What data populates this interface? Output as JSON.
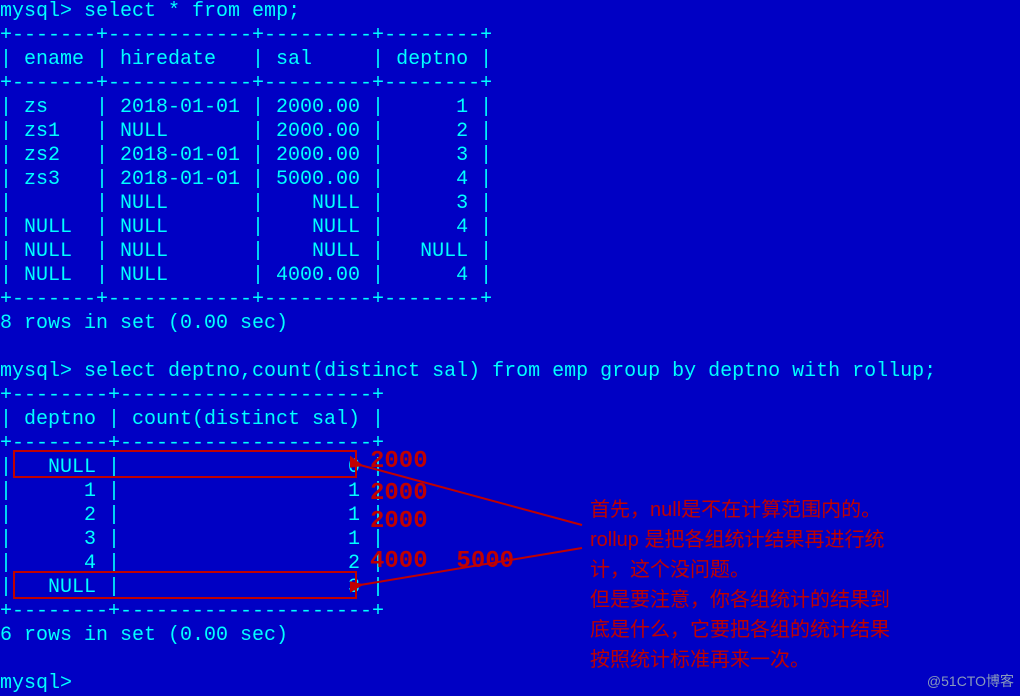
{
  "prompt": "mysql>",
  "query1": "select * from emp;",
  "border1_top": "+-------+------------+---------+--------+",
  "header1": "| ename | hiredate   | sal     | deptno |",
  "rows1": [
    "| zs    | 2018-01-01 | 2000.00 |      1 |",
    "| zs1   | NULL       | 2000.00 |      2 |",
    "| zs2   | 2018-01-01 | 2000.00 |      3 |",
    "| zs3   | 2018-01-01 | 5000.00 |      4 |",
    "|       | NULL       |    NULL |      3 |",
    "| NULL  | NULL       |    NULL |      4 |",
    "| NULL  | NULL       |    NULL |   NULL |",
    "| NULL  | NULL       | 4000.00 |      4 |"
  ],
  "status1": "8 rows in set (0.00 sec)",
  "query2": "select deptno,count(distinct sal) from emp group by deptno with rollup;",
  "border2_top": "+--------+---------------------+",
  "header2": "| deptno | count(distinct sal) |",
  "rows2": [
    "|   NULL |                   0 |",
    "|      1 |                   1 |",
    "|      2 |                   1 |",
    "|      3 |                   1 |",
    "|      4 |                   2 |",
    "|   NULL |                   3 |"
  ],
  "status2": "6 rows in set (0.00 sec)",
  "annotation_nums": {
    "r0": "2000",
    "r1": "2000",
    "r2": "2000",
    "r4": "4000  5000"
  },
  "annotation_text": {
    "l1": "首先，null是不在计算范围内的。",
    "l2": "rollup 是把各组统计结果再进行统",
    "l3": "计，这个没问题。",
    "l4": "但是要注意，你各组统计的结果到",
    "l5": "底是什么，它要把各组的统计结果",
    "l6": "按照统计标准再来一次。"
  },
  "watermark": "@51CTO博客",
  "chart_data": {
    "type": "table",
    "tables": [
      {
        "title": "emp",
        "columns": [
          "ename",
          "hiredate",
          "sal",
          "deptno"
        ],
        "rows": [
          [
            "zs",
            "2018-01-01",
            2000.0,
            1
          ],
          [
            "zs1",
            null,
            2000.0,
            2
          ],
          [
            "zs2",
            "2018-01-01",
            2000.0,
            3
          ],
          [
            "zs3",
            "2018-01-01",
            5000.0,
            4
          ],
          [
            "",
            null,
            null,
            3
          ],
          [
            null,
            null,
            null,
            4
          ],
          [
            null,
            null,
            null,
            null
          ],
          [
            null,
            null,
            4000.0,
            4
          ]
        ]
      },
      {
        "title": "group by deptno with rollup — count(distinct sal)",
        "columns": [
          "deptno",
          "count(distinct sal)"
        ],
        "rows": [
          [
            null,
            0
          ],
          [
            1,
            1
          ],
          [
            2,
            1
          ],
          [
            3,
            1
          ],
          [
            4,
            2
          ],
          [
            null,
            3
          ]
        ]
      }
    ]
  }
}
